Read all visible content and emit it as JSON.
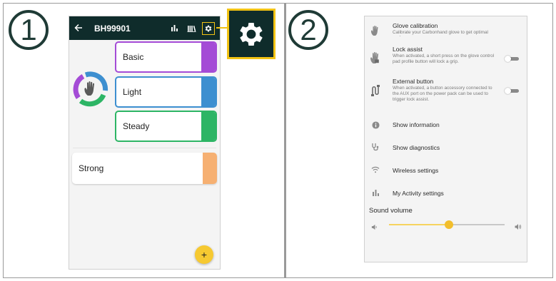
{
  "steps": {
    "one": "1",
    "two": "2"
  },
  "profiles_screen": {
    "back_icon": "arrow-left-icon",
    "device_id": "BH99901",
    "toolbar_icons": [
      "bar-chart-icon",
      "library-icon",
      "gear-icon"
    ],
    "profiles": [
      {
        "label": "Basic",
        "color": "#a44bd6"
      },
      {
        "label": "Light",
        "color": "#3d8fd0"
      },
      {
        "label": "Steady",
        "color": "#2db565"
      },
      {
        "label": "Strong",
        "color": "#f6b072"
      }
    ],
    "fab_label": "+"
  },
  "settings_screen": {
    "items": [
      {
        "title": "Glove calibration",
        "description": "Calibrate your Carbonhand glove to get optimal performance.",
        "icon": "hand-icon"
      },
      {
        "title": "Lock assist",
        "description": "When activated, a short press on the glove control pad profile button will lock a grip.",
        "icon": "hand-lock-icon",
        "toggle": false
      },
      {
        "title": "External button",
        "description": "When activated, a button accessory connected to the AUX port on the power pack can be used to trigger lock assist.",
        "icon": "cable-icon",
        "toggle": false
      },
      {
        "title": "Show information",
        "icon": "info-icon"
      },
      {
        "title": "Show diagnostics",
        "icon": "stethoscope-icon"
      },
      {
        "title": "Wireless settings",
        "icon": "wifi-icon"
      },
      {
        "title": "My Activity settings",
        "icon": "bar-chart-icon"
      }
    ],
    "volume": {
      "label": "Sound volume",
      "level": 0.52,
      "low_icon": "volume-low-icon",
      "high_icon": "volume-high-icon"
    }
  },
  "colors": {
    "appbar": "#0f2c2b",
    "highlight": "#f2c314",
    "fab": "#f6c931",
    "slider": "#f2be2c"
  }
}
